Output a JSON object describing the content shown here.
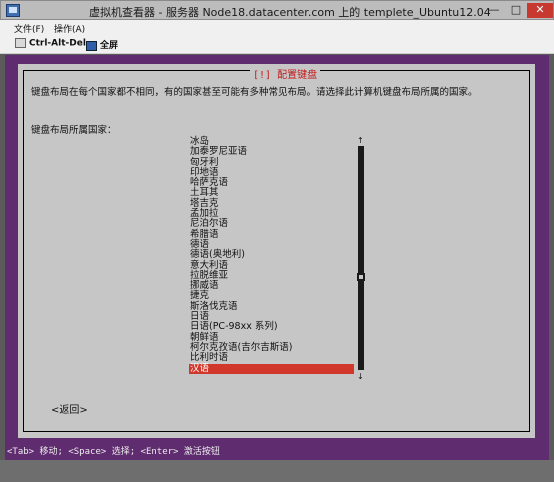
{
  "window": {
    "title": "虚拟机查看器 - 服务器 Node18.datacenter.com 上的 templete_Ubuntu12.04",
    "minimize": "—",
    "maximize": "□",
    "close": "✕"
  },
  "menu": {
    "items": [
      "文件(F)",
      "操作(A)"
    ]
  },
  "toolbar": {
    "ctrl_alt_del": "Ctrl-Alt-Del",
    "fullscreen": "全屏"
  },
  "dialog": {
    "title": "[!] 配置键盘",
    "prompt": "键盘布局在每个国家都不相同，有的国家甚至可能有多种常见布局。请选择此计算机键盘布局所属的国家。",
    "subprompt": "键盘布局所属国家：",
    "items": [
      "冰岛",
      "加泰罗尼亚语",
      "匈牙利",
      "印地语",
      "哈萨克语",
      "土耳其",
      "塔吉克",
      "孟加拉",
      "尼泊尔语",
      "希腊语",
      "德语",
      "德语(奥地利)",
      "意大利语",
      "拉脱维亚",
      "挪威语",
      "捷克",
      "斯洛伐克语",
      "日语",
      "日语(PC-98xx 系列)",
      "朝鲜语",
      "柯尔克孜语(吉尔吉斯语)",
      "比利时语",
      "汉语"
    ],
    "selected_index": 22,
    "scroll_position": 0.6,
    "scroll_up": "↑",
    "scroll_down": "↓",
    "back_button": "<返回>"
  },
  "status_line": "<Tab> 移动; <Space> 选择; <Enter> 激活按钮",
  "colors": {
    "background": "#5f2c70",
    "dialog": "#c6c6c6",
    "selected": "#d1372b",
    "title": "#c11b1b"
  }
}
